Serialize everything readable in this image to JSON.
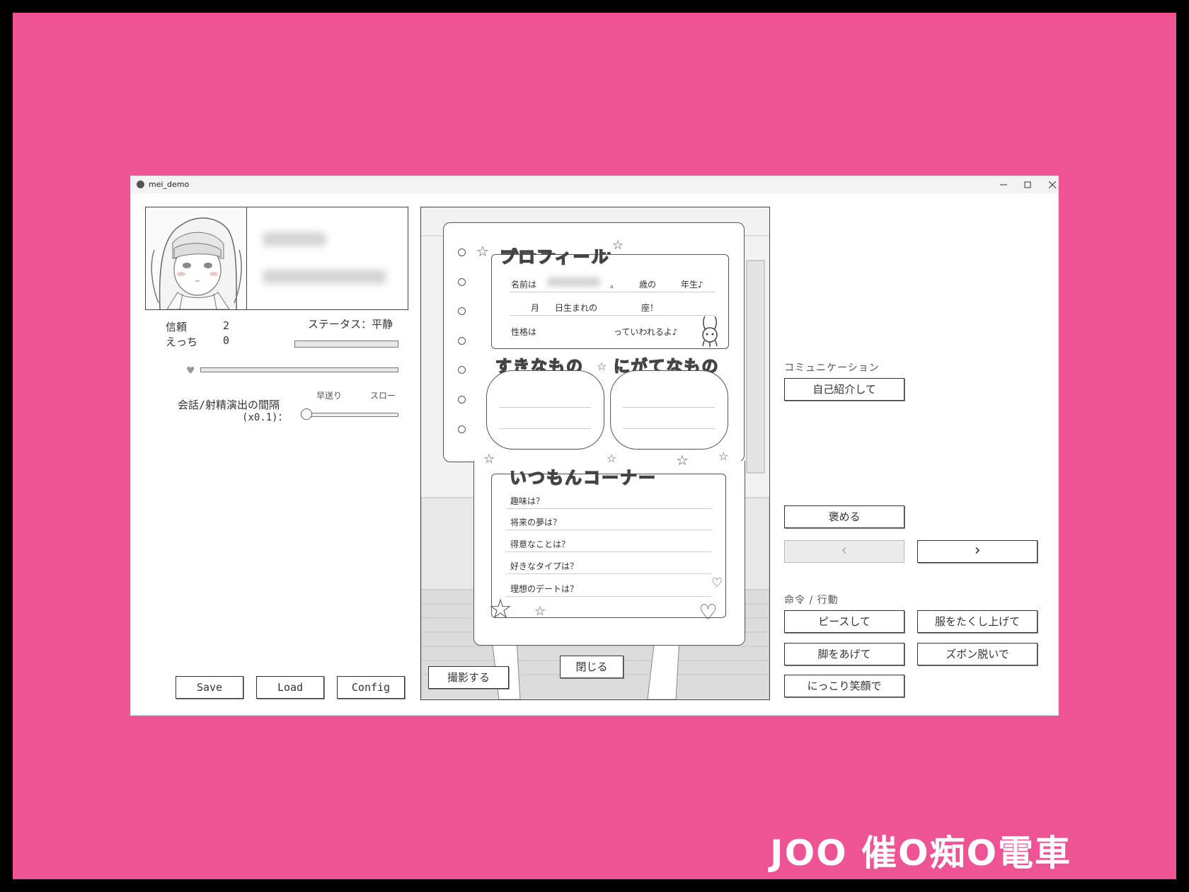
{
  "window": {
    "title": "mei_demo"
  },
  "status": {
    "trust_label": "信頼",
    "trust_value": "2",
    "ecchi_label": "えっち",
    "ecchi_value": "0",
    "status_text": "ステータス：平静",
    "interval_label_line1": "会話/射精演出の間隔",
    "interval_label_line2": "(x0.1)：",
    "fast_label": "早送り",
    "slow_label": "スロー",
    "heart_icon": "heart-icon"
  },
  "bottom_buttons": {
    "save": "Save",
    "load": "Load",
    "config": "Config"
  },
  "scene": {
    "profile_title": "プロフィール",
    "name_label": "名前は",
    "dot": "。",
    "age_label": "歳の",
    "grade_label": "年生♪",
    "month_label": "月",
    "birth_label": "日生まれの",
    "sign_label": "座！",
    "personality_label": "性格は",
    "said_label": "っていわれるよ♪",
    "likes_title": "すきなもの",
    "dislikes_title": "にがてなもの",
    "corner_title": "いつもんコーナー",
    "questions": [
      "趣味は？",
      "将来の夢は？",
      "得意なことは？",
      "好きなタイプは？",
      "理想のデートは？"
    ],
    "photo_button": "撮影する",
    "close_button": "閉じる"
  },
  "right": {
    "communication_label": "コミュニケーション",
    "intro_button": "自己紹介して",
    "praise_button": "褒める",
    "prev_button": "‹",
    "next_button": "›",
    "command_label": "命令 / 行動",
    "commands": [
      "ピースして",
      "服をたくし上げて",
      "脚をあげて",
      "ズボン脱いで",
      "にっこり笑顔で"
    ]
  },
  "watermark": "JOO 催O痴O電車"
}
